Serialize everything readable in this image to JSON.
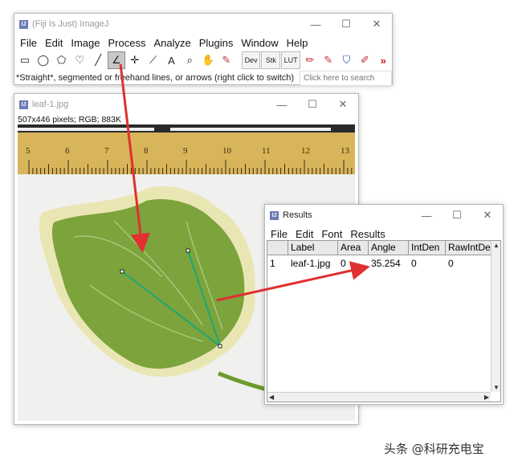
{
  "imagej": {
    "title": "(Fiji Is Just) ImageJ",
    "menu": [
      "File",
      "Edit",
      "Image",
      "Process",
      "Analyze",
      "Plugins",
      "Window",
      "Help"
    ],
    "tools": [
      {
        "name": "rectangle-tool-icon",
        "glyph": "▭"
      },
      {
        "name": "oval-tool-icon",
        "glyph": "◯"
      },
      {
        "name": "polygon-tool-icon",
        "glyph": "⬠"
      },
      {
        "name": "freehand-tool-icon",
        "glyph": "♡"
      },
      {
        "name": "line-tool-icon",
        "glyph": "╱"
      },
      {
        "name": "angle-tool-icon",
        "glyph": "∠"
      },
      {
        "name": "point-tool-icon",
        "glyph": "✛"
      },
      {
        "name": "wand-tool-icon",
        "glyph": "⟋"
      },
      {
        "name": "text-tool-icon",
        "glyph": "A"
      },
      {
        "name": "magnifier-tool-icon",
        "glyph": "⌕"
      },
      {
        "name": "hand-tool-icon",
        "glyph": "✋"
      },
      {
        "name": "color-picker-tool-icon",
        "glyph": "✎"
      }
    ],
    "extra_tools": [
      {
        "name": "dev-button",
        "label": "Dev"
      },
      {
        "name": "stk-button",
        "label": "Stk"
      },
      {
        "name": "lut-button",
        "label": "LUT"
      }
    ],
    "brush_tools": [
      {
        "name": "pencil-tool-icon",
        "glyph": "✏"
      },
      {
        "name": "brush-tool-icon",
        "glyph": "🖌"
      },
      {
        "name": "flood-fill-tool-icon",
        "glyph": "⛉"
      },
      {
        "name": "paintbrush-tool-icon",
        "glyph": "✐"
      }
    ],
    "more": "»",
    "status": "*Straight*, segmented or freehand lines, or arrows (right click to switch)",
    "search_placeholder": "Click here to search"
  },
  "leaf_window": {
    "title": "leaf-1.jpg",
    "info": "507x446 pixels; RGB; 883K",
    "ruler_labels": [
      "5",
      "6",
      "7",
      "8",
      "9",
      "10",
      "11",
      "12",
      "13"
    ]
  },
  "results": {
    "title": "Results",
    "menu": [
      "File",
      "Edit",
      "Font",
      "Results"
    ],
    "columns": [
      "",
      "Label",
      "Area",
      "Angle",
      "IntDen",
      "RawIntDen"
    ],
    "rows": [
      [
        "1",
        "leaf-1.jpg",
        "0",
        "35.254",
        "0",
        "0"
      ]
    ]
  },
  "window_controls": {
    "minimize": "—",
    "maximize": "☐",
    "close": "✕"
  },
  "watermark": "头条 @科研充电宝",
  "colors": {
    "arrow": "#e03030",
    "angle_line": "#1aa878",
    "leaf": "#7da33c"
  }
}
